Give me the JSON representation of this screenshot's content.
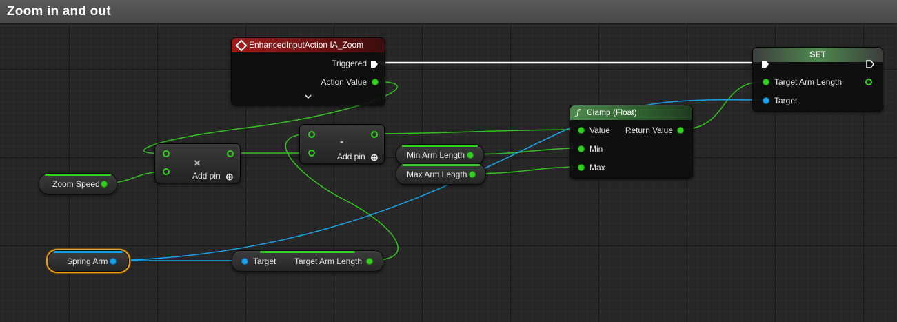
{
  "title": "Zoom in and out",
  "nodes": {
    "input_action": {
      "header": "EnhancedInputAction IA_Zoom",
      "triggered": "Triggered",
      "action_value": "Action Value",
      "expand_icon": "chevron-down-icon"
    },
    "set_node": {
      "header": "SET",
      "target_arm_length": "Target Arm Length",
      "target": "Target"
    },
    "clamp": {
      "header": "Clamp (Float)",
      "value": "Value",
      "min": "Min",
      "max": "Max",
      "return_value": "Return Value"
    },
    "multiply": {
      "op": "×",
      "add_pin": "Add pin",
      "add_pin_icon": "⊕"
    },
    "subtract": {
      "op": "-",
      "add_pin": "Add pin",
      "add_pin_icon": "⊕"
    },
    "zoom_speed": {
      "label": "Zoom Speed"
    },
    "min_arm_length": {
      "label": "Min Arm Length"
    },
    "max_arm_length": {
      "label": "Max Arm Length"
    },
    "spring_arm": {
      "label": "Spring Arm"
    },
    "get_arm_length": {
      "target": "Target",
      "output": "Target Arm Length"
    }
  },
  "colors": {
    "float_pin": "#33d11f",
    "object_pin": "#1aa3ea",
    "exec_wire": "#ffffff",
    "selection": "#e8a020"
  }
}
